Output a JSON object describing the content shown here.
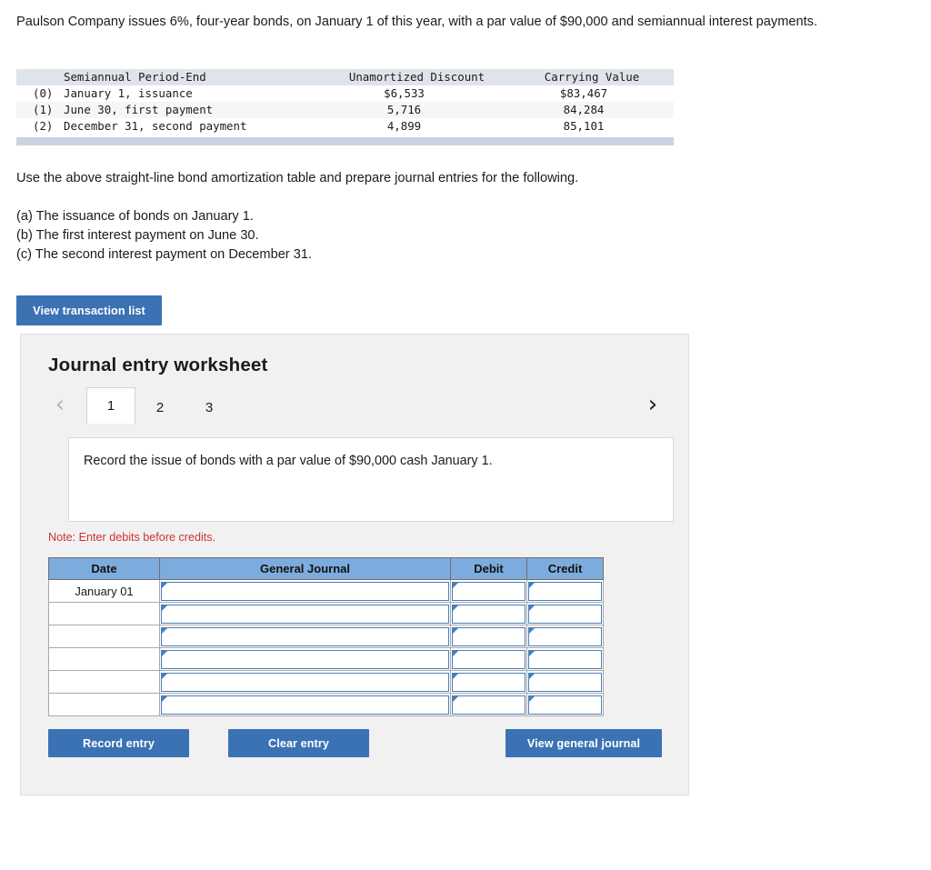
{
  "problem": {
    "statement": "Paulson Company issues 6%, four-year bonds, on January 1 of this year, with a par value of $90,000 and semiannual interest payments."
  },
  "amortization_table": {
    "headers": [
      "",
      "Semiannual Period-End",
      "Unamortized Discount",
      "Carrying Value"
    ],
    "rows": [
      {
        "index": "(0)",
        "period": "January 1, issuance",
        "discount": "$6,533",
        "carrying": "$83,467"
      },
      {
        "index": "(1)",
        "period": "June 30, first payment",
        "discount": "5,716",
        "carrying": "84,284"
      },
      {
        "index": "(2)",
        "period": "December 31, second payment",
        "discount": "4,899",
        "carrying": "85,101"
      }
    ]
  },
  "instructions": {
    "lead": "Use the above straight-line bond amortization table and prepare journal entries for the following.",
    "items": [
      "(a) The issuance of bonds on January 1.",
      "(b) The first interest payment on June 30.",
      "(c) The second interest payment on December 31."
    ]
  },
  "view_transaction_list_label": "View transaction list",
  "worksheet": {
    "title": "Journal entry worksheet",
    "nav": {
      "prev_icon": "‹",
      "next_icon": "›"
    },
    "tabs": [
      {
        "label": "1",
        "active": true
      },
      {
        "label": "2",
        "active": false
      },
      {
        "label": "3",
        "active": false
      }
    ],
    "prompt": "Record the issue of bonds with a par value of $90,000 cash January 1.",
    "note": "Note: Enter debits before credits.",
    "journal": {
      "headers": [
        "Date",
        "General Journal",
        "Debit",
        "Credit"
      ],
      "rows": [
        {
          "date": "January 01",
          "general_journal": "",
          "debit": "",
          "credit": ""
        },
        {
          "date": "",
          "general_journal": "",
          "debit": "",
          "credit": ""
        },
        {
          "date": "",
          "general_journal": "",
          "debit": "",
          "credit": ""
        },
        {
          "date": "",
          "general_journal": "",
          "debit": "",
          "credit": ""
        },
        {
          "date": "",
          "general_journal": "",
          "debit": "",
          "credit": ""
        },
        {
          "date": "",
          "general_journal": "",
          "debit": "",
          "credit": ""
        }
      ]
    },
    "buttons": {
      "record": "Record entry",
      "clear": "Clear entry",
      "view_general_journal": "View general journal"
    }
  },
  "colors": {
    "primary_button": "#3b72b3",
    "table_header": "#7cacdd",
    "note_text": "#cc3333",
    "panel_bg": "#f1f1f1",
    "amort_header_bg": "#dfe3ea",
    "amort_footer_bar": "#ccd3e0",
    "field_border": "#4a7ebb"
  }
}
